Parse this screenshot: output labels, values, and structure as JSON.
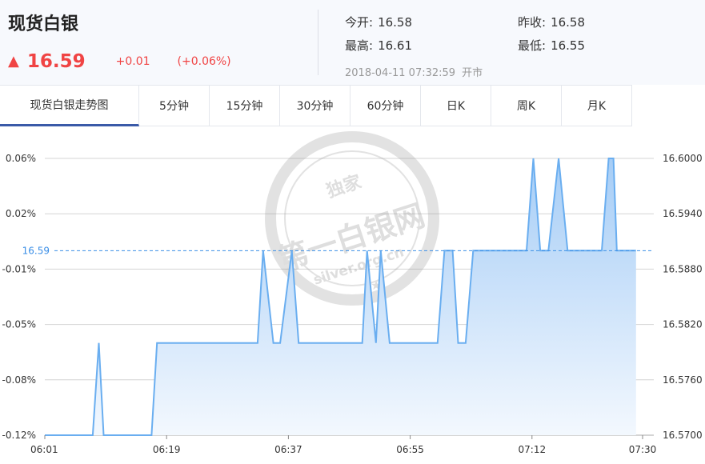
{
  "header": {
    "title": "现货白银",
    "arrow_icon": "triangle-up-icon",
    "price": "16.59",
    "change": "+0.01",
    "change_pct": "(+0.06%)",
    "open_label": "今开:",
    "open_value": "16.58",
    "prev_close_label": "昨收:",
    "prev_close_value": "16.58",
    "high_label": "最高:",
    "high_value": "16.61",
    "low_label": "最低:",
    "low_value": "16.55",
    "timestamp": "2018-04-11 07:32:59",
    "market_status": "开市",
    "up_color": "#f04444"
  },
  "tabs": [
    {
      "label": "现货白银走势图",
      "active": true
    },
    {
      "label": "5分钟"
    },
    {
      "label": "15分钟"
    },
    {
      "label": "30分钟"
    },
    {
      "label": "60分钟"
    },
    {
      "label": "日K"
    },
    {
      "label": "周K"
    },
    {
      "label": "月K"
    }
  ],
  "watermark": {
    "top_text": "独家",
    "main_text": "第一白银网",
    "url_text": "silver.org.cn"
  },
  "chart_data": {
    "type": "area",
    "x_tick_labels": [
      "06:01",
      "06:19",
      "06:37",
      "06:55",
      "07:12",
      "07:30"
    ],
    "y_left_tick_labels": [
      "0.06%",
      "0.02%",
      "-0.01%",
      "-0.05%",
      "-0.08%",
      "-0.12%"
    ],
    "y_right_tick_labels": [
      "16.6000",
      "16.5940",
      "16.5880",
      "16.5820",
      "16.5760",
      "16.5700"
    ],
    "ylim": [
      16.57,
      16.6
    ],
    "reference_value": 16.59,
    "reference_label": "16.59",
    "line_color": "#6aaef0",
    "reference_color": "#3a8ee6",
    "series": [
      {
        "x": [
          0,
          7,
          7.9,
          8.6,
          9.4,
          15.6,
          16.4,
          31.1,
          31.9,
          33.4,
          34.4,
          36.1,
          37.1,
          46.4,
          47.1,
          48.4,
          49.1,
          50.4,
          51.4,
          57.4,
          58.4,
          59.6,
          60.4,
          61.5,
          62.6,
          64.4,
          65.4,
          70.4,
          71.4,
          72.4,
          73.6,
          75.1,
          76.4,
          81.4,
          82.4,
          83.1,
          83.6,
          86.4
        ],
        "y": [
          16.57,
          16.57,
          16.58,
          16.57,
          16.57,
          16.57,
          16.58,
          16.58,
          16.59,
          16.58,
          16.58,
          16.59,
          16.58,
          16.58,
          16.59,
          16.58,
          16.59,
          16.58,
          16.58,
          16.58,
          16.59,
          16.59,
          16.58,
          16.58,
          16.59,
          16.59,
          16.59,
          16.59,
          16.6,
          16.59,
          16.59,
          16.6,
          16.59,
          16.59,
          16.6,
          16.6,
          16.59,
          16.59
        ]
      }
    ]
  }
}
